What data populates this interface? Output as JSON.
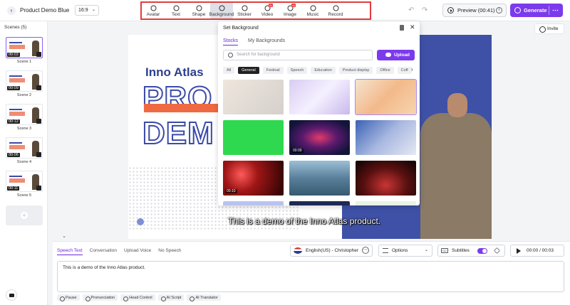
{
  "header": {
    "project_title": "Product Demo Blue",
    "aspect_ratio": "16:9",
    "tools": [
      {
        "label": "Avatar",
        "icon": "avatar-icon"
      },
      {
        "label": "Text",
        "icon": "text-icon"
      },
      {
        "label": "Shape",
        "icon": "shape-icon"
      },
      {
        "label": "Background",
        "icon": "background-icon",
        "active": true
      },
      {
        "label": "Sticker",
        "icon": "sticker-icon"
      },
      {
        "label": "Video",
        "icon": "video-icon",
        "badge": "AI"
      },
      {
        "label": "Image",
        "icon": "image-icon",
        "badge": "AI"
      },
      {
        "label": "Music",
        "icon": "music-icon"
      },
      {
        "label": "Record",
        "icon": "record-icon"
      }
    ],
    "preview_label": "Preview (00:41)",
    "generate_label": "Generate",
    "invite_label": "Invite",
    "accent_color": "#7c3aed",
    "highlight_border_color": "#e23b3b"
  },
  "scenes": {
    "title": "Scenes (5)",
    "items": [
      {
        "name": "Scene 1",
        "duration": "00:03",
        "active": true
      },
      {
        "name": "Scene 2",
        "duration": "00:09"
      },
      {
        "name": "Scene 3",
        "duration": "00:12"
      },
      {
        "name": "Scene 4",
        "duration": "00:06"
      },
      {
        "name": "Scene 5",
        "duration": "00:11"
      }
    ]
  },
  "canvas": {
    "brand": "Inno Atlas",
    "headline_1": "PRO",
    "headline_2": "DEM",
    "subtitle": "This is a demo of the Inno Atlas product."
  },
  "background_panel": {
    "title": "Set Background",
    "tabs": [
      "Stocks",
      "My Backgrounds"
    ],
    "active_tab": "Stocks",
    "search_placeholder": "Search for background",
    "upload_label": "Upload",
    "categories": [
      "All",
      "General",
      "Festival",
      "Speech",
      "Education",
      "Product display",
      "Office",
      "Coff"
    ],
    "active_category": "General",
    "thumbnails": [
      {
        "style": "beige-gradient"
      },
      {
        "style": "lavender-gradient"
      },
      {
        "style": "peach-gradient",
        "selected": true
      },
      {
        "style": "green-screen"
      },
      {
        "style": "red-blue-tunnel",
        "duration": "00:09"
      },
      {
        "style": "blue-watercolor"
      },
      {
        "style": "red-bokeh",
        "duration": "00:10"
      },
      {
        "style": "blue-mist"
      },
      {
        "style": "red-stage"
      }
    ]
  },
  "bottom": {
    "tabs": [
      "Speech Text",
      "Conversation",
      "Upload Voice",
      "No Speech"
    ],
    "active_tab": "Speech Text",
    "voice": "English(US) - Christopher",
    "options_label": "Options",
    "subtitles_label": "Subtitles",
    "subtitles_on": true,
    "time": "00:00 / 00:03",
    "speech_text": "This is a demo of the Inno Atlas product.",
    "tools": [
      "Pause",
      "Pronunciation",
      "Head Control",
      "AI Script",
      "AI Translator"
    ]
  }
}
